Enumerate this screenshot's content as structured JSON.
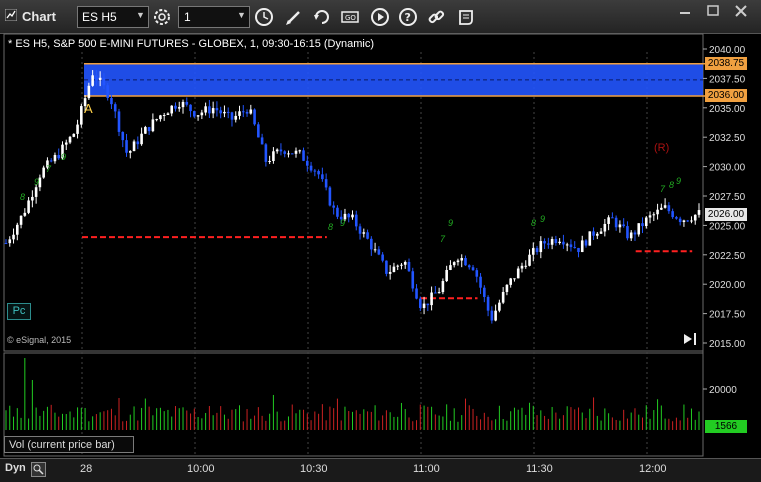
{
  "window": {
    "title": "Chart"
  },
  "toolbar": {
    "symbol_value": "ES H5",
    "interval_value": "1",
    "dropdown_glyph": "▼",
    "icons": [
      "gear-icon",
      "clock-icon",
      "pencil-icon",
      "refresh-icon",
      "text-tool-icon",
      "play-icon",
      "help-icon",
      "link-icon",
      "script-icon"
    ]
  },
  "chart": {
    "header": "* ES H5, S&P 500 E-MINI FUTURES - GLOBEX, 1, 09:30-16:15 (Dynamic)",
    "copyright": "© eSignal, 2015",
    "pc_label": "Pc",
    "marker_a": "A",
    "marker_r": "(R)",
    "price_labels": {
      "upper": "2038.75",
      "lower": "2036.00",
      "last": "2026.00"
    }
  },
  "chart_data": [
    {
      "type": "candlestick",
      "ylim": [
        2015,
        2040
      ],
      "y_ticks": [
        "2040.00",
        "2037.50",
        "2035.00",
        "2032.50",
        "2030.00",
        "2027.50",
        "2025.00",
        "2022.50",
        "2020.00",
        "2017.50",
        "2015.00"
      ],
      "x_ticks": [
        "28",
        "10:00",
        "10:30",
        "11:00",
        "11:30",
        "12:00"
      ],
      "zone": {
        "high": 2038.75,
        "low": 2036.0,
        "color": "#2255ff"
      },
      "levels": [
        {
          "price": 2024.0,
          "from": "09:30",
          "to": "10:35",
          "color": "#ff2020"
        },
        {
          "price": 2018.8,
          "from": "11:00",
          "to": "11:15",
          "color": "#ff2020"
        },
        {
          "price": 2022.8,
          "from": "11:57",
          "to": "12:12",
          "color": "#ff2020"
        }
      ],
      "path": [
        2023.5,
        2026,
        2029.5,
        2031,
        2033,
        2038,
        2036,
        2031,
        2033,
        2034.5,
        2035.5,
        2034.5,
        2035,
        2034,
        2035,
        2030.5,
        2031.5,
        2031,
        2029.5,
        2026,
        2025.5,
        2023.5,
        2021,
        2022,
        2018,
        2019.5,
        2022.5,
        2021.5,
        2017,
        2020,
        2022,
        2023.5,
        2024,
        2023,
        2024.5,
        2025.5,
        2024,
        2025.5,
        2026.5,
        2025.5,
        2026
      ]
    },
    {
      "type": "bar",
      "title": "Vol (current price bar)",
      "y_ticks": [
        "20000"
      ],
      "last_value": "1566"
    }
  ],
  "bottom": {
    "mode": "Dyn"
  },
  "colors": {
    "up": "#ffffff",
    "down": "#2255ff",
    "zone": "#2255ff",
    "level": "#ff2020",
    "count": "#22aa22",
    "vol_up": "#22cc22",
    "vol_down": "#cc2222"
  }
}
